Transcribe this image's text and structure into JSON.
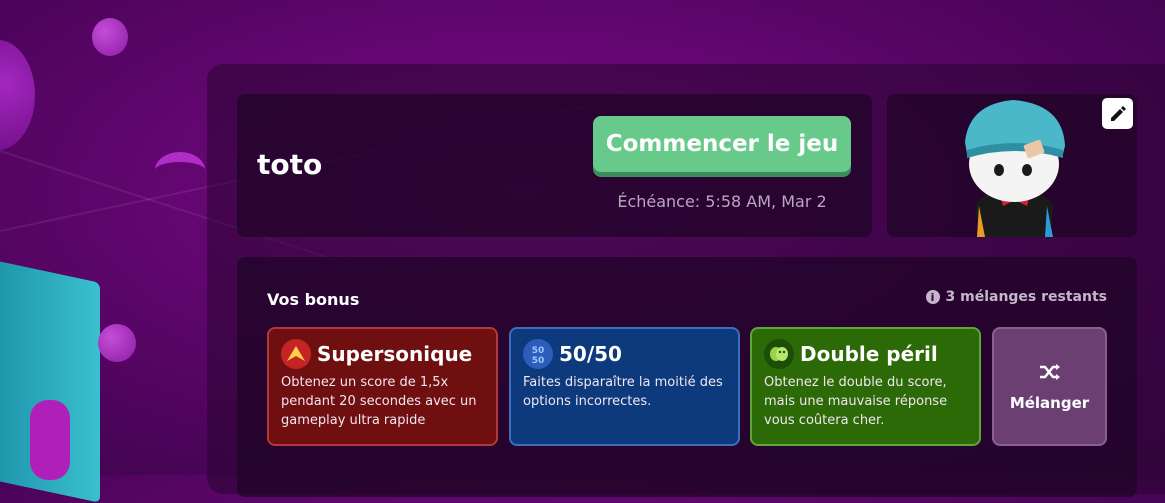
{
  "player": {
    "name": "toto"
  },
  "start": {
    "label": "Commencer le jeu",
    "deadline": "Échéance: 5:58 AM, Mar 2"
  },
  "avatar": {
    "edit_icon": "pencil-icon"
  },
  "bonuses": {
    "title": "Vos bonus",
    "shuffles_remaining": "3 mélanges restants",
    "items": [
      {
        "name": "Supersonique",
        "description": "Obtenez un score de 1,5x pendant 20 secondes avec un gameplay ultra rapide",
        "icon": "supersonic-icon",
        "color": "#6f0f10",
        "border": "#b03a3a"
      },
      {
        "name": "50/50",
        "description": "Faites disparaître la moitié des options incorrectes.",
        "icon": "fifty-fifty-icon",
        "color": "#0d3a7c",
        "border": "#3d6dbb"
      },
      {
        "name": "Double péril",
        "description": "Obtenez le double du score, mais une mauvaise réponse vous coûtera cher.",
        "icon": "masks-icon",
        "color": "#2b6a07",
        "border": "#5ea53a"
      }
    ],
    "shuffle_label": "Mélanger"
  }
}
